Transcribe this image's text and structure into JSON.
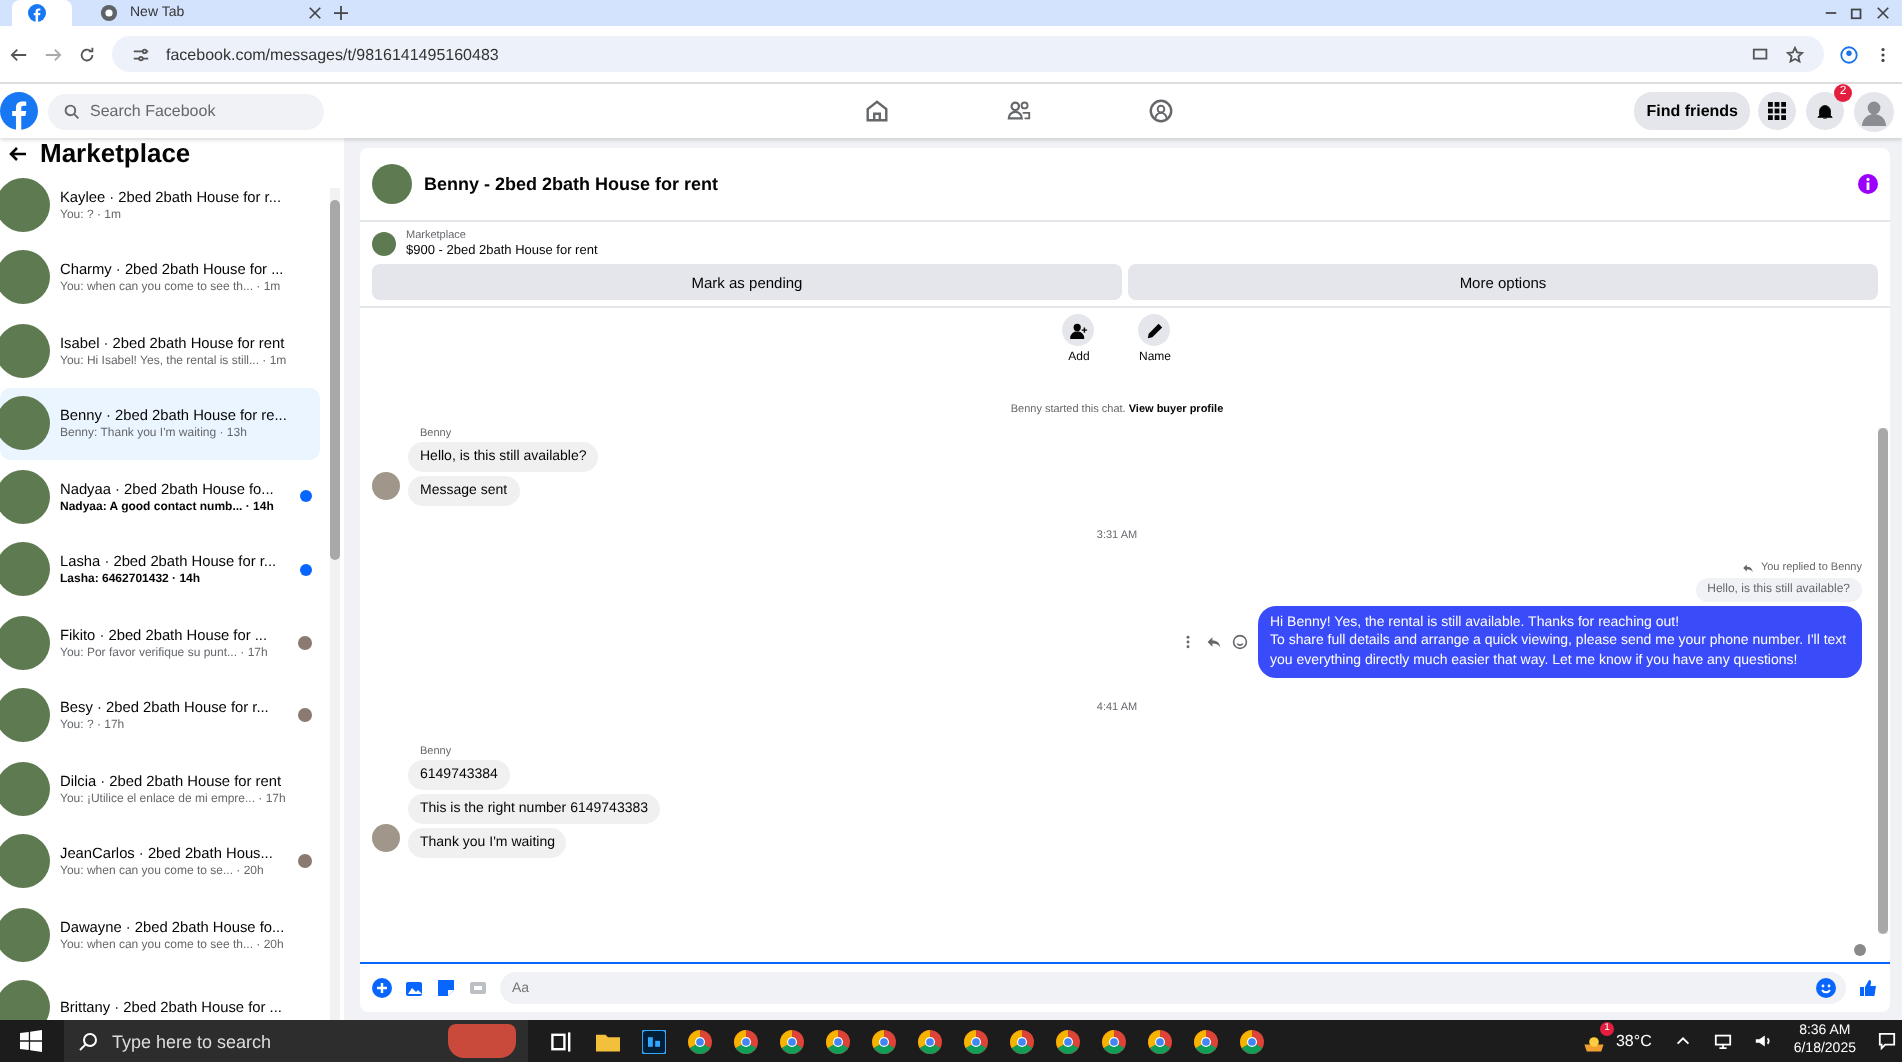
{
  "browser": {
    "tabs": [
      {
        "kind": "facebook",
        "selected": true
      },
      {
        "title": "New Tab",
        "kind": "newtab",
        "selected": false
      }
    ],
    "url": "facebook.com/messages/t/9816141495160483"
  },
  "topbar": {
    "search_placeholder": "Search Facebook",
    "find_friends": "Find friends",
    "notification_count": "2"
  },
  "sidebar": {
    "title": "Marketplace",
    "conversations": [
      {
        "title": "Kaylee · 2bed 2bath House for r...",
        "preview": "You: ? · 1m",
        "selected": false,
        "unread": false,
        "seen": false
      },
      {
        "title": "Charmy · 2bed 2bath House for ...",
        "preview": "You: when can you come to see th... · 1m",
        "selected": false,
        "unread": false,
        "seen": false
      },
      {
        "title": "Isabel · 2bed 2bath House for rent",
        "preview": "You: Hi Isabel! Yes, the rental is still... · 1m",
        "selected": false,
        "unread": false,
        "seen": false
      },
      {
        "title": "Benny · 2bed 2bath House for re...",
        "preview": "Benny: Thank you I'm waiting · 13h",
        "selected": true,
        "unread": false,
        "seen": false
      },
      {
        "title": "Nadyaa · 2bed 2bath House fo...",
        "preview": "Nadyaa: A good contact numb... · 14h",
        "selected": false,
        "unread": true,
        "seen": false
      },
      {
        "title": "Lasha · 2bed 2bath House for r...",
        "preview": "Lasha: 6462701432 · 14h",
        "selected": false,
        "unread": true,
        "seen": false
      },
      {
        "title": "Fikito · 2bed 2bath House for ...",
        "preview": "You: Por favor verifique su punt... · 17h",
        "selected": false,
        "unread": false,
        "seen": true
      },
      {
        "title": "Besy · 2bed 2bath House for r...",
        "preview": "You: ? · 17h",
        "selected": false,
        "unread": false,
        "seen": true
      },
      {
        "title": "Dilcia · 2bed 2bath House for rent",
        "preview": "You: ¡Utilice el enlace de mi empre... · 17h",
        "selected": false,
        "unread": false,
        "seen": false
      },
      {
        "title": "JeanCarlos · 2bed 2bath Hous...",
        "preview": "You: when can you come to se... · 20h",
        "selected": false,
        "unread": false,
        "seen": true
      },
      {
        "title": "Dawayne · 2bed 2bath House fo...",
        "preview": "You: when can you come to see th... · 20h",
        "selected": false,
        "unread": false,
        "seen": false
      },
      {
        "title": "Brittany · 2bed 2bath House for ...",
        "selected": false,
        "unread": false,
        "seen": false
      }
    ]
  },
  "chat": {
    "title": "Benny - 2bed 2bath House for rent",
    "listing": {
      "label": "Marketplace",
      "text": "$900 - 2bed 2bath House for rent"
    },
    "actions": [
      "Mark as pending",
      "More options"
    ],
    "profile_actions": [
      {
        "label": "Add",
        "kind": "add"
      },
      {
        "label": "Name",
        "kind": "name"
      }
    ],
    "messages": [
      {
        "kind": "notice",
        "text": "Benny started this chat.",
        "link": "View buyer profile"
      },
      {
        "kind": "group",
        "sender": "Benny",
        "bubbles": [
          "Hello, is this still available?",
          "Message sent"
        ]
      },
      {
        "kind": "time",
        "text": "3:31 AM"
      },
      {
        "kind": "reply",
        "note": "You replied to Benny",
        "quoted": "Hello, is this still available?",
        "text": "Hi Benny! Yes, the rental is still available. Thanks for reaching out!\nTo share full details and arrange a quick viewing, please send me your phone number. I'll text you everything directly much easier that way. Let me know if you have any questions!"
      },
      {
        "kind": "time",
        "text": "4:41 AM"
      },
      {
        "kind": "group",
        "sender": "Benny",
        "bubbles": [
          "6149743384",
          "This is the right number 6149743383",
          "Thank you I'm waiting"
        ]
      }
    ],
    "composer_placeholder": "Aa"
  },
  "taskbar": {
    "search_placeholder": "Type here to search",
    "apps": [
      {
        "kind": "explorer"
      },
      {
        "kind": "photoshop"
      },
      {
        "kind": "chrome"
      },
      {
        "kind": "chrome"
      },
      {
        "kind": "chrome"
      },
      {
        "kind": "chrome"
      },
      {
        "kind": "chrome"
      },
      {
        "kind": "chrome"
      },
      {
        "kind": "chrome"
      },
      {
        "kind": "chrome"
      },
      {
        "kind": "chrome"
      },
      {
        "kind": "chrome"
      },
      {
        "kind": "chrome"
      },
      {
        "kind": "chrome"
      },
      {
        "kind": "chrome"
      }
    ],
    "weather_badge": "1",
    "temperature": "38°C",
    "time": "8:36 AM",
    "date": "6/18/2025"
  }
}
